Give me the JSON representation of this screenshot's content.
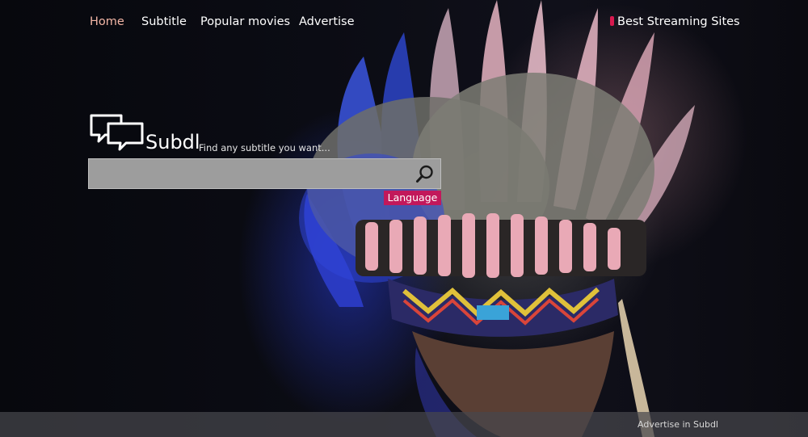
{
  "nav": {
    "items": [
      {
        "label": "Home",
        "active": true
      },
      {
        "label": "Subtitle",
        "active": false
      },
      {
        "label": "Popular movies",
        "active": false
      },
      {
        "label": "Advertise",
        "active": false
      }
    ],
    "streaming_label": "Best Streaming Sites"
  },
  "logo": {
    "name": "Subdl",
    "tagline": "Find any subtitle you want..."
  },
  "search": {
    "value": "",
    "placeholder": ""
  },
  "language_button": "Language",
  "footer": {
    "link_label": "Advertise in Subdl"
  },
  "colors": {
    "accent": "#c2185b",
    "nav_active": "#f2b6a6",
    "search_bg": "#9d9d9d",
    "footer_bg": "#46464c"
  },
  "icons": {
    "search": "search-icon",
    "logo": "chat-bubbles-icon"
  }
}
